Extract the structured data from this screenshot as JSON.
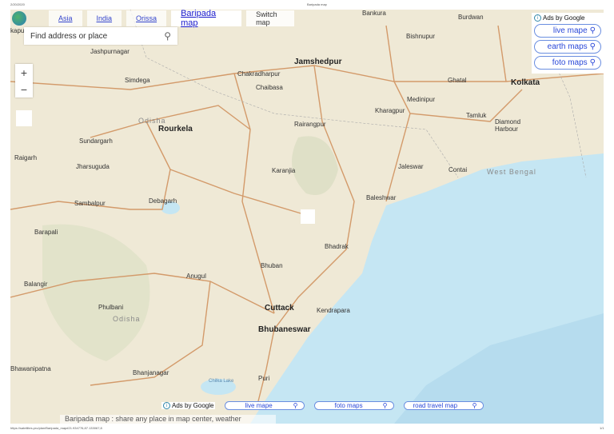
{
  "print_header": {
    "date": "2/20/2020",
    "title": "Baripada map"
  },
  "print_footer": {
    "url": "https://satellites.pro/plan/Baripada_map#21.934776,87.133067,8",
    "page": "1/1"
  },
  "breadcrumbs": [
    {
      "label": "Asia"
    },
    {
      "label": "India"
    },
    {
      "label": "Orissa"
    }
  ],
  "current_map": "Baripada map",
  "switch_map": "Switch map",
  "search": {
    "placeholder": "Find address or place"
  },
  "zoom": {
    "plus": "+",
    "minus": "−"
  },
  "ads_top": {
    "label": "Ads by Google",
    "buttons": [
      "live mape",
      "earth maps",
      "foto maps"
    ]
  },
  "ads_bottom": {
    "label": "Ads by Google",
    "buttons": [
      "live mape",
      "foto maps",
      "road travel map"
    ]
  },
  "footer_text": "Baripada map : share any place in map center, weather",
  "colors": {
    "land": "#efe9d6",
    "sea": "#c5e6f3",
    "road": "#d39a6a",
    "link": "#2a48d8"
  },
  "cities": [
    {
      "name": "Bankura"
    },
    {
      "name": "Burdwan"
    },
    {
      "name": "Bishnupur"
    },
    {
      "name": "Jamshedpur",
      "big": true
    },
    {
      "name": "Jashpurnagar"
    },
    {
      "name": "Chakradharpur"
    },
    {
      "name": "Simdega"
    },
    {
      "name": "Chaibasa"
    },
    {
      "name": "Ghatal"
    },
    {
      "name": "Kolkata",
      "big": true
    },
    {
      "name": "Medinipur"
    },
    {
      "name": "Kharagpur"
    },
    {
      "name": "Tamluk"
    },
    {
      "name": "Diamond Harbour"
    },
    {
      "name": "Odisha",
      "region": true
    },
    {
      "name": "Rourkela",
      "big": true
    },
    {
      "name": "Rairangpur"
    },
    {
      "name": "Sundargarh"
    },
    {
      "name": "Raigarh"
    },
    {
      "name": "Jharsuguda"
    },
    {
      "name": "Karanjia"
    },
    {
      "name": "Jaleswar"
    },
    {
      "name": "Contai"
    },
    {
      "name": "West Bengal",
      "region": true
    },
    {
      "name": "Baleshwar"
    },
    {
      "name": "Sambalpur"
    },
    {
      "name": "Debagarh"
    },
    {
      "name": "Barapali"
    },
    {
      "name": "Bhadrak"
    },
    {
      "name": "Bhuban"
    },
    {
      "name": "Balangir"
    },
    {
      "name": "Anugul"
    },
    {
      "name": "Cuttack",
      "big": true
    },
    {
      "name": "Phulbani"
    },
    {
      "name": "Kendrapara"
    },
    {
      "name": "Odisha",
      "region": true
    },
    {
      "name": "Bhubaneswar",
      "big": true
    },
    {
      "name": "Bhawanipatna"
    },
    {
      "name": "Bhanjanagar"
    },
    {
      "name": "Puri"
    },
    {
      "name": "Chilka Lake"
    },
    {
      "name": "kapur"
    }
  ]
}
